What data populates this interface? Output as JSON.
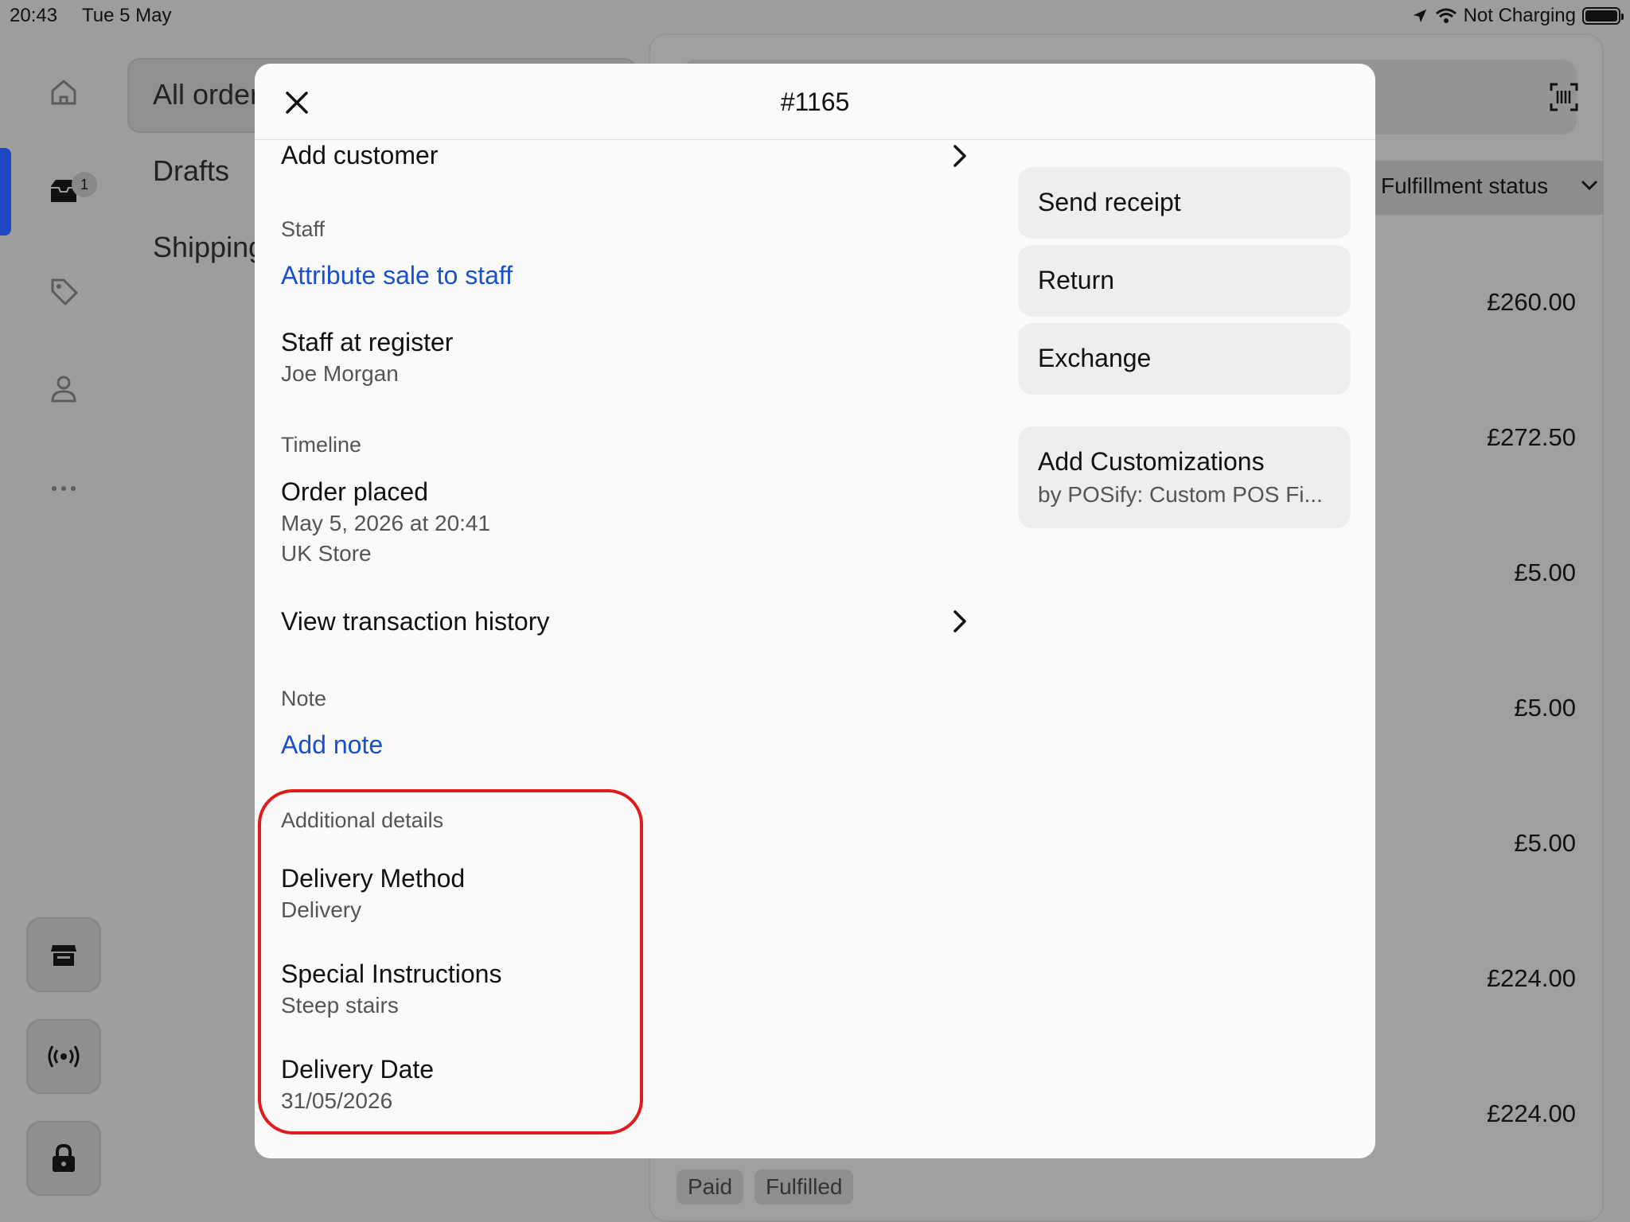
{
  "status_bar": {
    "time": "20:43",
    "date": "Tue 5 May",
    "charging": "Not Charging"
  },
  "sidebar": {
    "icons": [
      "home-icon",
      "orders-inbox-icon",
      "tag-icon",
      "person-icon",
      "more-dots-icon"
    ],
    "orders_badge": "1",
    "bottom_buttons": [
      "store-icon",
      "broadcast-icon",
      "lock-icon"
    ]
  },
  "nav": {
    "items": [
      {
        "label": "All orders"
      },
      {
        "label": "Drafts"
      },
      {
        "label": "Shipping"
      }
    ]
  },
  "orders_list": {
    "column_header": "Fulfillment status",
    "prices": [
      "£260.00",
      "£272.50",
      "£5.00",
      "£5.00",
      "£5.00",
      "£224.00",
      "£224.00"
    ],
    "chips": [
      "Paid",
      "Fulfilled"
    ]
  },
  "modal": {
    "title": "#1165",
    "add_customer": "Add customer",
    "staff_label": "Staff",
    "attribute_link": "Attribute sale to staff",
    "staff_at_register": "Staff at register",
    "staff_name": "Joe Morgan",
    "timeline_label": "Timeline",
    "order_placed": "Order placed",
    "order_date": "May 5, 2026 at 20:41",
    "order_store": "UK Store",
    "view_history": "View transaction history",
    "note_label": "Note",
    "add_note": "Add note",
    "additional_label": "Additional details",
    "details": [
      {
        "title": "Delivery Method",
        "value": "Delivery"
      },
      {
        "title": "Special Instructions",
        "value": "Steep stairs"
      },
      {
        "title": "Delivery Date",
        "value": "31/05/2026"
      }
    ],
    "actions": {
      "send_receipt": "Send receipt",
      "return": "Return",
      "exchange": "Exchange",
      "customizations_title": "Add Customizations",
      "customizations_sub": "by POSify: Custom POS Fi..."
    }
  },
  "colors": {
    "link": "#1a4fd0",
    "highlight": "#e01b1b",
    "rail_active": "#1f47c4"
  }
}
